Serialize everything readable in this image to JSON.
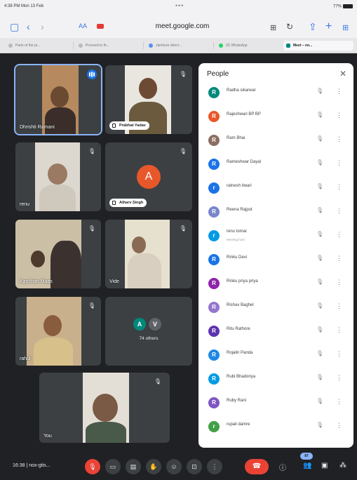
{
  "status": {
    "time": "4:38 PM  Mon 13 Feb",
    "battery": "77%"
  },
  "browser": {
    "url": "meet.google.com",
    "text_size": "AA",
    "tabs": [
      "Parts of the pr...",
      "Proceed to th...",
      "Jamhure direct...",
      "(9) WhatsApp",
      "Meet – no..."
    ]
  },
  "tiles": {
    "t1_name": "Dhrishti Ramani",
    "t2_name": "Prabhat Yadav",
    "t3_name": "renu",
    "t4_name": "Atharv Singh",
    "t4_avatar": "A",
    "t5_name": "Kanchan Maas",
    "t6_name": "Vide",
    "t7_name": "rahul",
    "t8_av1": "A",
    "t8_av2": "V",
    "t8_label": "74 others",
    "you_label": "You"
  },
  "people": {
    "title": "People",
    "close": "✕",
    "list": [
      {
        "name": "Radha sikarwar",
        "avatar": "R",
        "color": "#00897b"
      },
      {
        "name": "Rajeshwari BP BP",
        "avatar": "R",
        "color": "#e8572a"
      },
      {
        "name": "Ram Bhai",
        "avatar": "R",
        "color": "#8d6e63"
      },
      {
        "name": "Rameshwar Dayal",
        "avatar": "R",
        "color": "#1a73e8"
      },
      {
        "name": "ratnesh tiwari",
        "avatar": "r",
        "color": "#1a73e8"
      },
      {
        "name": "Reena Rajput",
        "avatar": "R",
        "color": "#7986cb"
      },
      {
        "name": "renu tomar",
        "sub": "Meeting host",
        "avatar": "r",
        "color": "#039be5"
      },
      {
        "name": "Rinku Devi",
        "avatar": "R",
        "color": "#1a73e8"
      },
      {
        "name": "Rinku priya priya",
        "avatar": "R",
        "color": "#8e24aa"
      },
      {
        "name": "Rishav Baghel",
        "avatar": "R",
        "color": "#9575cd"
      },
      {
        "name": "Ritu Rathore",
        "avatar": "R",
        "color": "#5e35b1"
      },
      {
        "name": "Rojalin Panda",
        "avatar": "R",
        "color": "#1e88e5"
      },
      {
        "name": "Rubi Bhadoriya",
        "avatar": "R",
        "color": "#039be5"
      },
      {
        "name": "Ruby Rani",
        "avatar": "R",
        "color": "#7e57c2"
      },
      {
        "name": "rupali damre",
        "avatar": "r",
        "color": "#43a047"
      }
    ]
  },
  "controls": {
    "meeting_info": "16:38  |  nox-gtis...",
    "participants_count": "87"
  }
}
